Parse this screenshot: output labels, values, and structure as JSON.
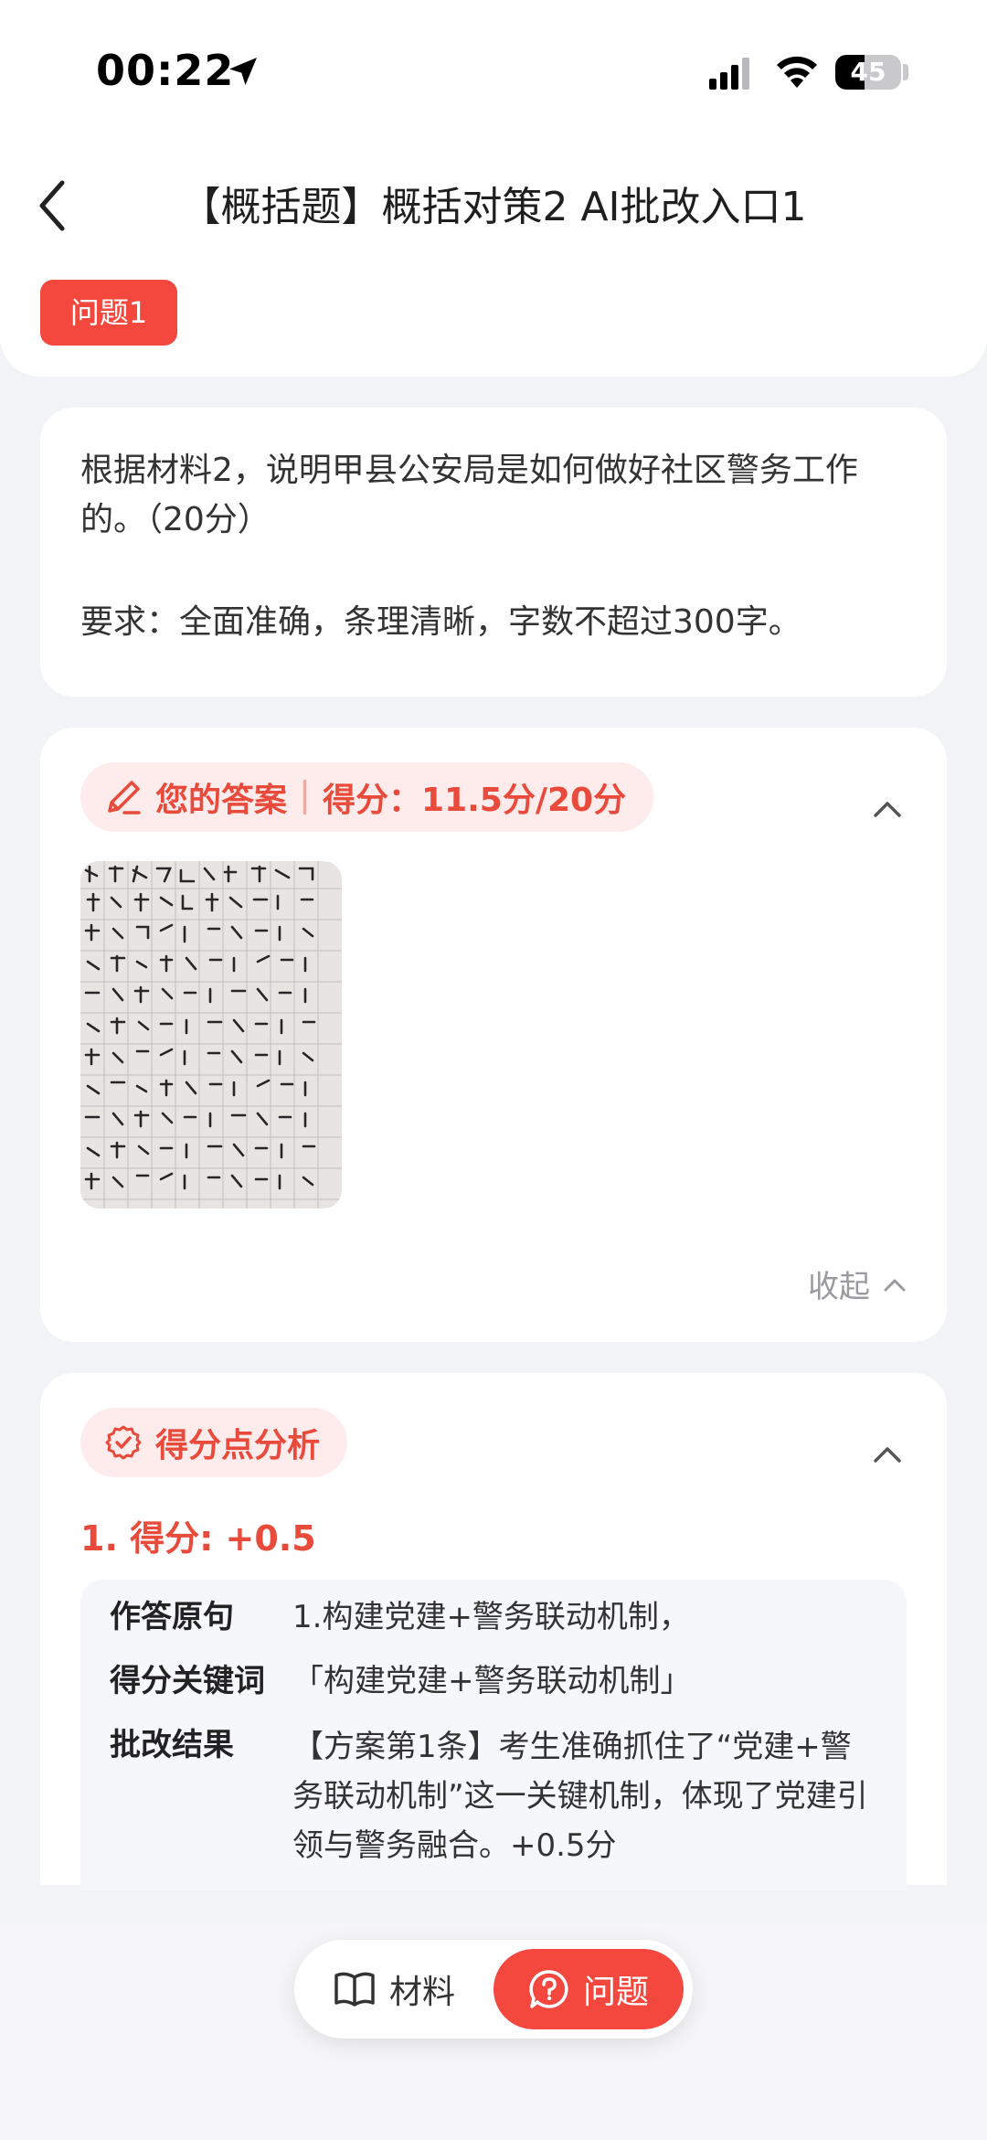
{
  "status_bar": {
    "time": "00:22",
    "battery": "45",
    "battery_level": 0.45
  },
  "header": {
    "title": "【概括题】概括对策2 AI批改入口1",
    "question_tab": "问题1"
  },
  "question": {
    "text": "根据材料2，说明甲县公安局是如何做好社区警务工作的。（20分）",
    "requirement": "要求：全面准确，条理清晰，字数不超过300字。"
  },
  "answer": {
    "label": "您的答案",
    "score": "得分：11.5分/20分",
    "collapse_label": "收起"
  },
  "analysis": {
    "label": "得分点分析",
    "items": [
      {
        "score": "1. 得分: +0.5",
        "original_label": "作答原句",
        "original": "1.构建党建+警务联动机制，",
        "keyword_label": "得分关键词",
        "keyword": "「构建党建+警务联动机制」",
        "result_label": "批改结果",
        "result": "【方案第1条】考生准确抓住了“党建+警务联动机制”这一关键机制，体现了党建引领与警务融合。+0.5分"
      }
    ]
  },
  "tabbar": {
    "material": "材料",
    "question": "问题"
  },
  "colors": {
    "accent": "#f4473e",
    "accent_text": "#e84a3b",
    "pill_bg": "#fdeceb"
  }
}
